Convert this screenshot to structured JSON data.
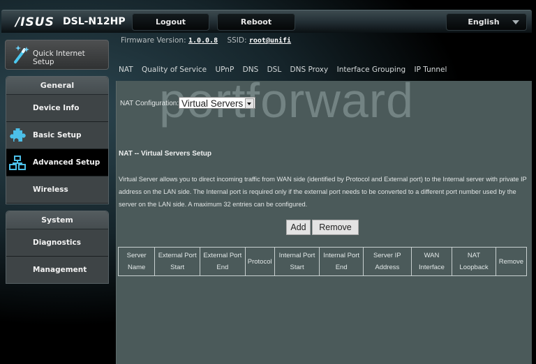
{
  "header": {
    "brand": "/ISUS",
    "model": "DSL-N12HP",
    "logout_label": "Logout",
    "reboot_label": "Reboot",
    "language": "English",
    "firmware_label": "Firmware Version:",
    "firmware_value": "1.0.0.8",
    "ssid_label": "SSID:",
    "ssid_value": "root@unifi"
  },
  "sidebar": {
    "quick_setup_label": "Quick Internet Setup",
    "groups": [
      {
        "title": "General",
        "items": [
          {
            "label": "Device Info",
            "icon": "none"
          },
          {
            "label": "Basic Setup",
            "icon": "puzzle-icon"
          },
          {
            "label": "Advanced Setup",
            "icon": "network-icon",
            "active": true
          },
          {
            "label": "Wireless",
            "icon": "none"
          }
        ]
      },
      {
        "title": "System",
        "items": [
          {
            "label": "Diagnostics"
          },
          {
            "label": "Management"
          }
        ]
      }
    ]
  },
  "subtabs": [
    "NAT",
    "Quality of Service",
    "UPnP",
    "DNS",
    "DSL",
    "DNS Proxy",
    "Interface Grouping",
    "IP Tunnel"
  ],
  "watermark": "portforward",
  "main": {
    "nat_config_label": "NAT Configuration:",
    "nat_config_value": "Virtual Servers",
    "section_title": "NAT -- Virtual Servers Setup",
    "description": "Virtual Server allows you to direct incoming traffic from WAN side (identified by Protocol and External port) to the Internal server with private IP address on the LAN side. The Internal port is required only if the external port needs to be converted to a different port number used by the server on the LAN side. A maximum 32 entries can be configured.",
    "add_label": "Add",
    "remove_label": "Remove",
    "table_headers": [
      [
        "Server",
        "Name"
      ],
      [
        "External Port",
        "Start"
      ],
      [
        "External Port",
        "End"
      ],
      [
        "Protocol"
      ],
      [
        "Internal Port",
        "Start"
      ],
      [
        "Internal Port",
        "End"
      ],
      [
        "Server IP",
        "Address"
      ],
      [
        "WAN",
        "Interface"
      ],
      [
        "NAT",
        "Loopback"
      ],
      [
        "Remove"
      ]
    ]
  }
}
